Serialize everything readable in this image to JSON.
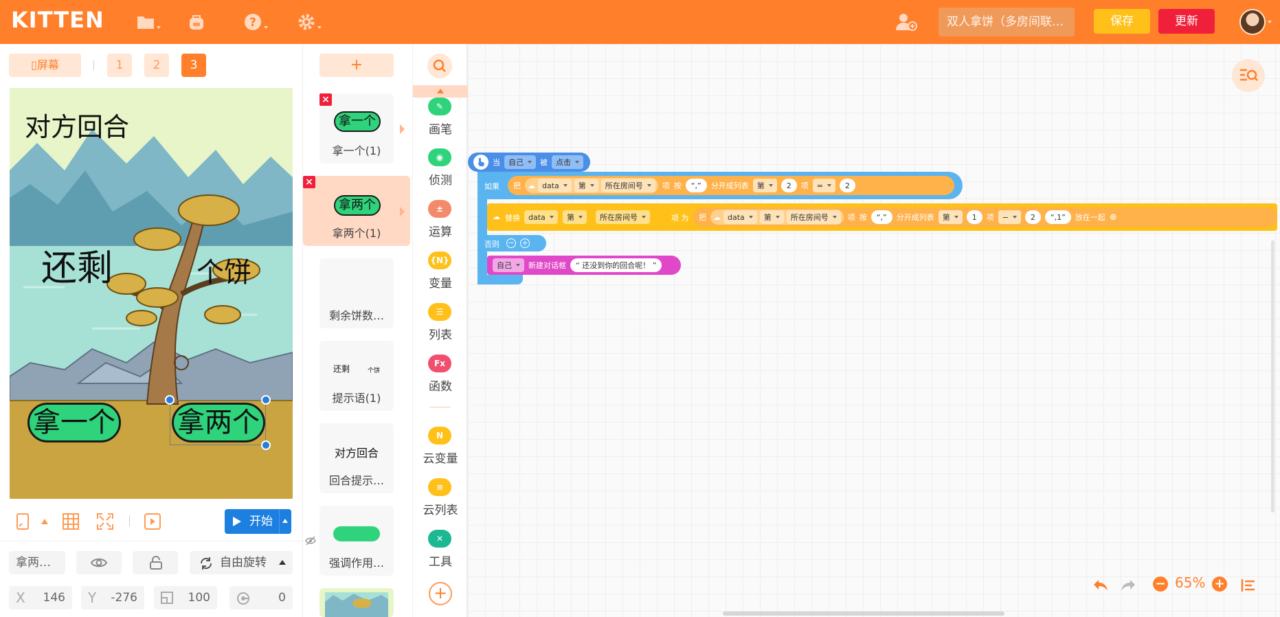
{
  "header": {
    "logo": "KITTEN",
    "project_name": "双人拿饼（多房间联…",
    "save_label": "保存",
    "update_label": "更新",
    "icons": [
      "folder-icon",
      "backpack-icon",
      "help-icon",
      "gear-icon",
      "add-user-icon",
      "avatar"
    ],
    "accent": "#ff7f2a"
  },
  "stage_panel": {
    "screen_label": "屏幕",
    "pages": [
      "1",
      "2",
      "3"
    ],
    "active_page": "3",
    "stage": {
      "texts": {
        "turn": "对方回合",
        "remaining": "还剩",
        "unit": "个饼"
      },
      "buttons": [
        "拿一个",
        "拿两个"
      ]
    },
    "start_label": "开始",
    "props": {
      "name": "拿两…",
      "rotation_mode": "自由旋转",
      "x_label": "X",
      "x": "146",
      "y_label": "Y",
      "y": "-276",
      "size": "100",
      "direction": "0"
    }
  },
  "sprites": {
    "add_label": "+",
    "items": [
      {
        "name": "拿一个(1)",
        "thumb_text": "拿一个"
      },
      {
        "name": "拿两个(1)",
        "thumb_text": "拿两个",
        "selected": true
      },
      {
        "name": "剩余饼数…",
        "thumb_text": ""
      },
      {
        "name": "提示语(1)",
        "thumb_text": "还剩",
        "thumb_text2": "个饼"
      },
      {
        "name": "回合提示…",
        "thumb_text": "对方回合"
      },
      {
        "name": "强调作用…",
        "thumb_text": ""
      }
    ]
  },
  "categories": {
    "items": [
      {
        "label": "画笔",
        "color": "#2fd37b",
        "glyph": "✎"
      },
      {
        "label": "侦测",
        "color": "#2fd37b",
        "glyph": "◉"
      },
      {
        "label": "运算",
        "color": "#f38a6b",
        "glyph": "±"
      },
      {
        "label": "变量",
        "color": "#ffc119",
        "glyph": "{N}"
      },
      {
        "label": "列表",
        "color": "#ffc119",
        "glyph": "☰"
      },
      {
        "label": "函数",
        "color": "#f0506e",
        "glyph": "Fx"
      },
      {
        "label": "云变量",
        "color": "#ffc119",
        "glyph": "N"
      },
      {
        "label": "云列表",
        "color": "#ffc119",
        "glyph": "≡"
      },
      {
        "label": "工具",
        "color": "#1cb892",
        "glyph": "✕"
      }
    ]
  },
  "script": {
    "hat": {
      "when": "当",
      "target": "自己",
      "is": "被",
      "event": "点击"
    },
    "if_block": {
      "if": "如果",
      "put": "把",
      "var": "data",
      "nth": "第",
      "room": "所在房间号",
      "item": "项",
      "by": "按",
      "sep": "“,”",
      "split": "分开成列表",
      "nth2": "第",
      "idx": "2",
      "item2": "项",
      "op": "=",
      "value": "2"
    },
    "replace_block": {
      "replace": "替换",
      "var": "data",
      "nth": "第",
      "room": "所在房间号",
      "item_as": "项 为",
      "put": "把",
      "var2": "data",
      "nth2": "第",
      "room2": "所在房间号",
      "item": "项",
      "by": "按",
      "sep": "“,”",
      "split": "分开成列表",
      "nth3": "第",
      "idx": "1",
      "item2": "项",
      "op": "−",
      "sub": "2",
      "join_str": "“,1”",
      "join": "放在一起"
    },
    "else_label": "否则",
    "say_block": {
      "target": "自己",
      "action": "新建对话框",
      "text": "“ 还没到你的回合呢！ ”"
    }
  },
  "workspace": {
    "zoom": "65%"
  }
}
